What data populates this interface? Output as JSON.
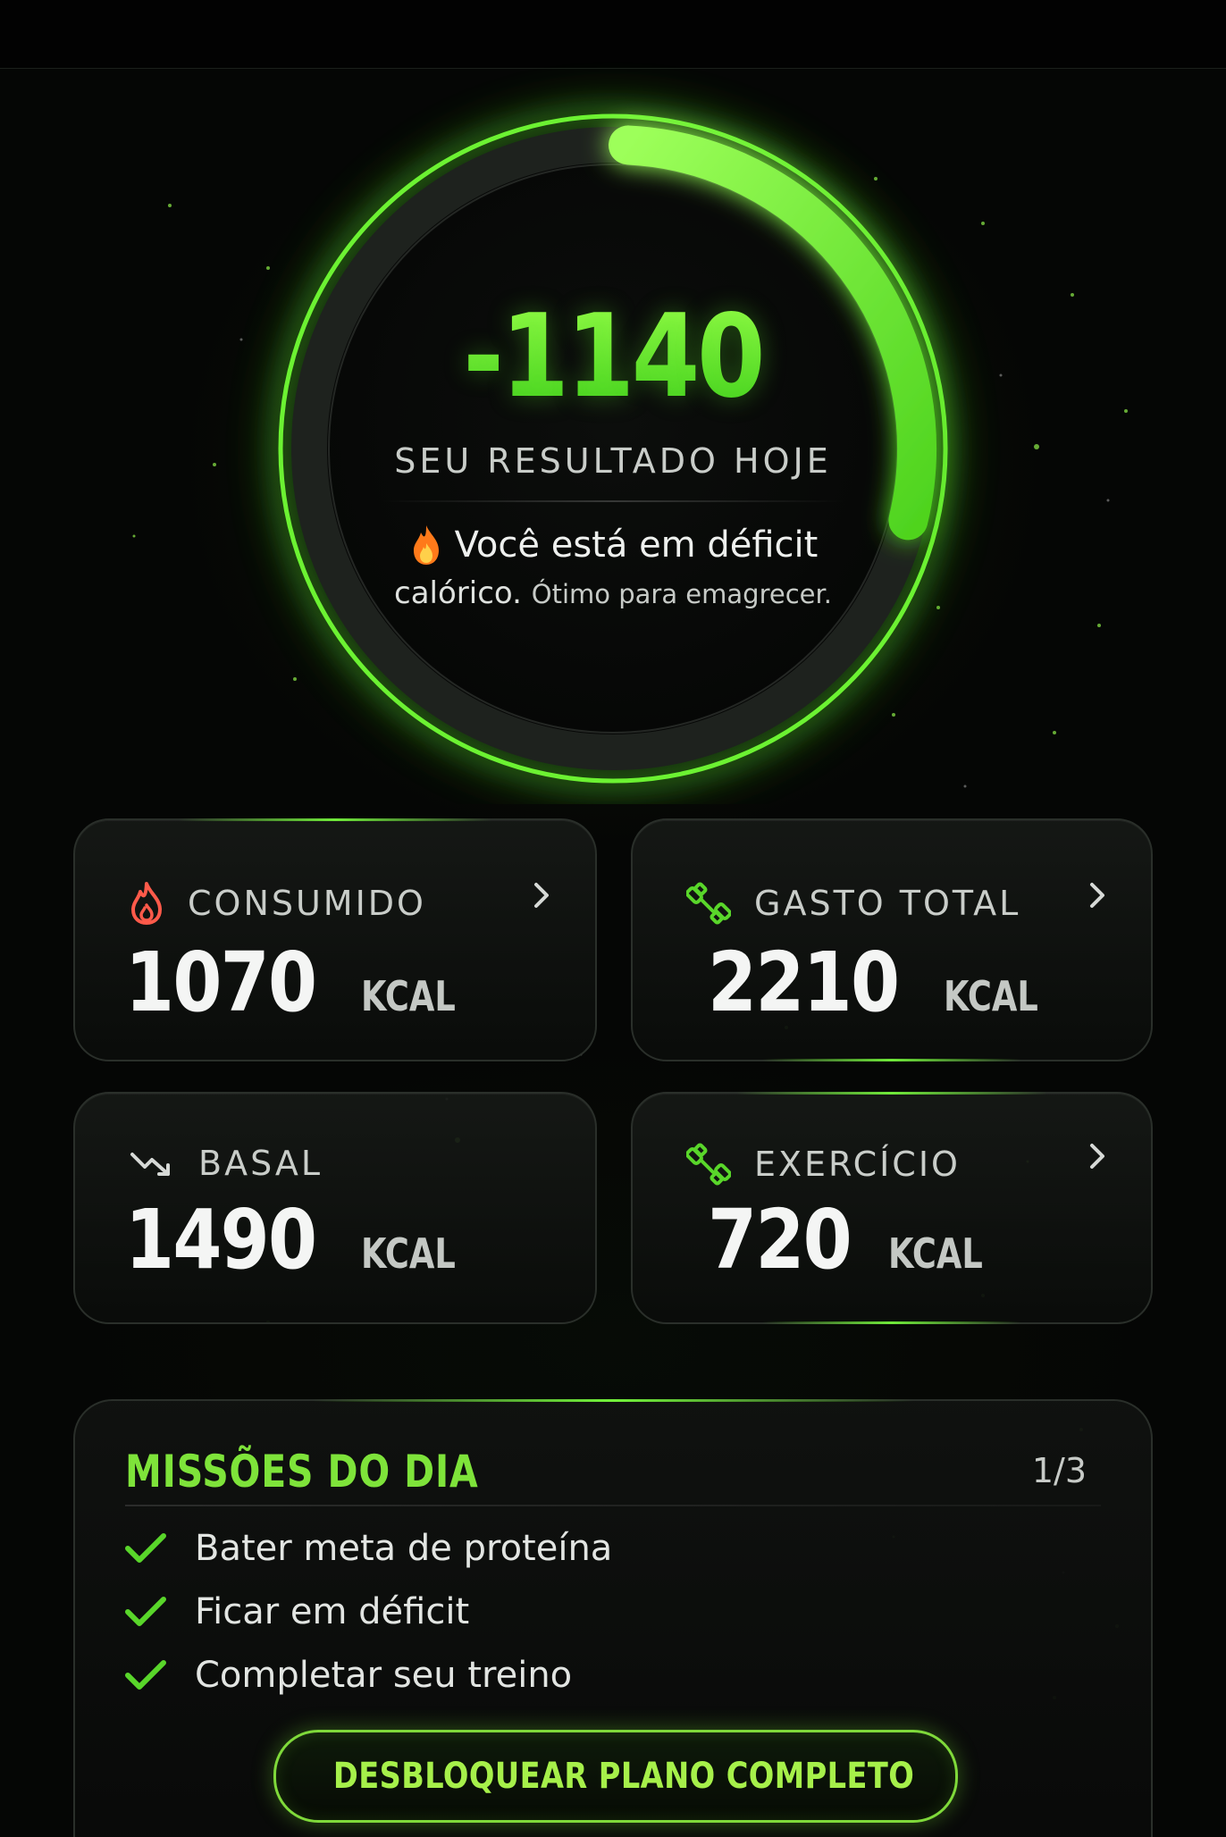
{
  "summary": {
    "value": "-1140",
    "label": "SEU RESULTADO HOJE",
    "message_main": "Você está em déficit",
    "message_cont": "calórico.",
    "message_small": "Ótimo para emagrecer.",
    "progress": 0.28
  },
  "stats": {
    "consumed": {
      "title": "CONSUMIDO",
      "value": "1070",
      "unit": "KCAL",
      "icon": "flame-icon"
    },
    "total_spent": {
      "title": "GASTO TOTAL",
      "value": "2210",
      "unit": "KCAL",
      "icon": "dumbbell-icon"
    },
    "basal": {
      "title": "BASAL",
      "value": "1490",
      "unit": "KCAL",
      "icon": "trend-down-icon"
    },
    "exercise": {
      "title": "EXERCÍCIO",
      "value": "720",
      "unit": "KCAL",
      "icon": "dumbbell-icon"
    }
  },
  "missions": {
    "title": "MISSÕES DO DIA",
    "count": "1/3",
    "items": [
      {
        "label": "Bater meta de proteína",
        "done": true
      },
      {
        "label": "Ficar em déficit",
        "done": true
      },
      {
        "label": "Completar seu treino",
        "done": true
      }
    ],
    "unlock_label": "DESBLOQUEAR PLANO COMPLETO"
  },
  "colors": {
    "accent": "#6fe030",
    "background": "#050605",
    "flame": "#ff5a4a"
  }
}
